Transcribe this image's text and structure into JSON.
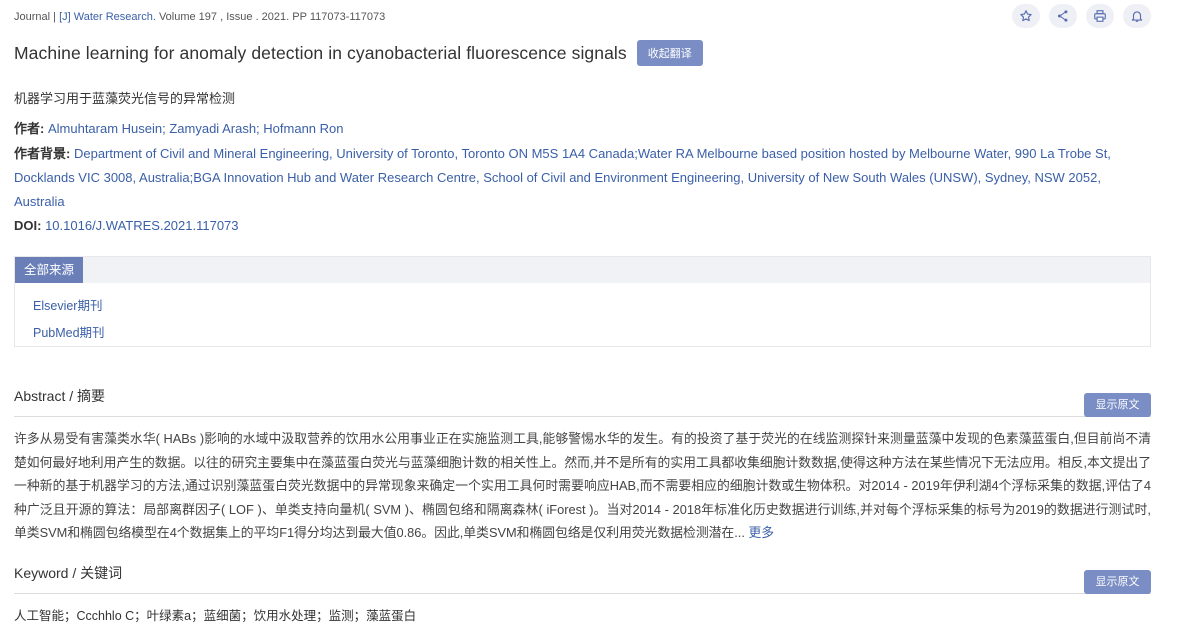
{
  "header": {
    "type": "Journal",
    "sep": " | ",
    "jtag": "[J]",
    "journal": "Water Research.",
    "volume": "Volume 197",
    "issue": ", Issue . 2021.",
    "pages": "PP 117073-117073"
  },
  "toolbar": {
    "star_icon": "star-icon",
    "share_icon": "share-icon",
    "print_icon": "print-icon",
    "bell_icon": "bell-icon"
  },
  "paper": {
    "title": "Machine learning for anomaly detection in cyanobacterial fluorescence signals",
    "collapse_label": "收起翻译",
    "title_translation": "机器学习用于蓝藻荧光信号的异常检测",
    "authors_label": "作者:",
    "authors": "Almuhtaram Husein; Zamyadi Arash; Hofmann Ron",
    "affiliation_label": "作者背景:",
    "affiliation": "Department of Civil and Mineral Engineering, University of Toronto, Toronto ON M5S 1A4 Canada;Water RA Melbourne based position hosted by Melbourne Water, 990 La Trobe St, Docklands VIC 3008, Australia;BGA Innovation Hub and Water Research Centre, School of Civil and Environment Engineering, University of New South Wales (UNSW), Sydney, NSW 2052, Australia",
    "doi_label": "DOI:",
    "doi": "10.1016/J.WATRES.2021.117073"
  },
  "sources": {
    "tab": "全部来源",
    "items": [
      "Elsevier期刊",
      "PubMed期刊"
    ]
  },
  "abstract": {
    "title": "Abstract / 摘要",
    "show_original": "显示原文",
    "text": "许多从易受有害藻类水华( HABs )影响的水域中汲取营养的饮用水公用事业正在实施监测工具,能够警惕水华的发生。有的投资了基于荧光的在线监测探针来测量蓝藻中发现的色素藻蓝蛋白,但目前尚不清楚如何最好地利用产生的数据。以往的研究主要集中在藻蓝蛋白荧光与蓝藻细胞计数的相关性上。然而,并不是所有的实用工具都收集细胞计数数据,使得这种方法在某些情况下无法应用。相反,本文提出了一种新的基于机器学习的方法,通过识别藻蓝蛋白荧光数据中的异常现象来确定一个实用工具何时需要响应HAB,而不需要相应的细胞计数或生物体积。对2014 - 2019年伊利湖4个浮标采集的数据,评估了4种广泛且开源的算法：局部离群因子( LOF )、单类支持向量机( SVM )、椭圆包络和隔离森林( iForest )。当对2014 - 2018年标准化历史数据进行训练,并对每个浮标采集的标号为2019的数据进行测试时,单类SVM和椭圆包络模型在4个数据集上的平均F1得分均达到最大值0.86。因此,单类SVM和椭圆包络是仅利用荧光数据检测潜在...",
    "more": "更多"
  },
  "keyword": {
    "title": "Keyword / 关键词",
    "show_original": "显示原文",
    "text": "人工智能；Ccchhlo C；叶绿素a；蓝细菌；饮用水处理；监测；藻蓝蛋白"
  }
}
